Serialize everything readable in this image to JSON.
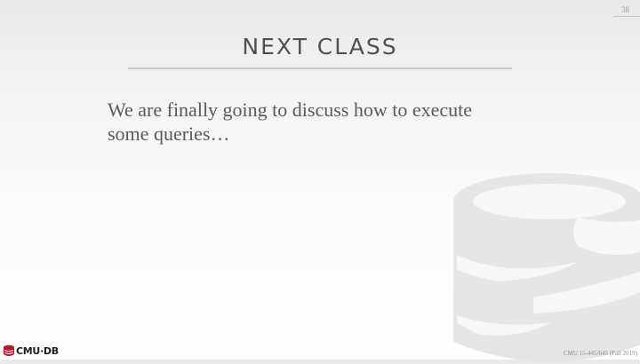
{
  "slide": {
    "page_number": "38",
    "title": "NEXT CLASS",
    "body": "We are finally going to discuss how to execute some queries…"
  },
  "footer": {
    "logo_text": "CMU·DB",
    "course": "CMU 15-445/645 (Fall 2019)"
  },
  "colors": {
    "background": "#f4f4f4",
    "title": "#505050",
    "body_text": "#5a5a5a",
    "watermark": "#e6e6e6",
    "logo_accent": "#b01c2e"
  },
  "icons": {
    "watermark": "database-watermark-icon",
    "logo": "cmu-db-logo-icon"
  }
}
